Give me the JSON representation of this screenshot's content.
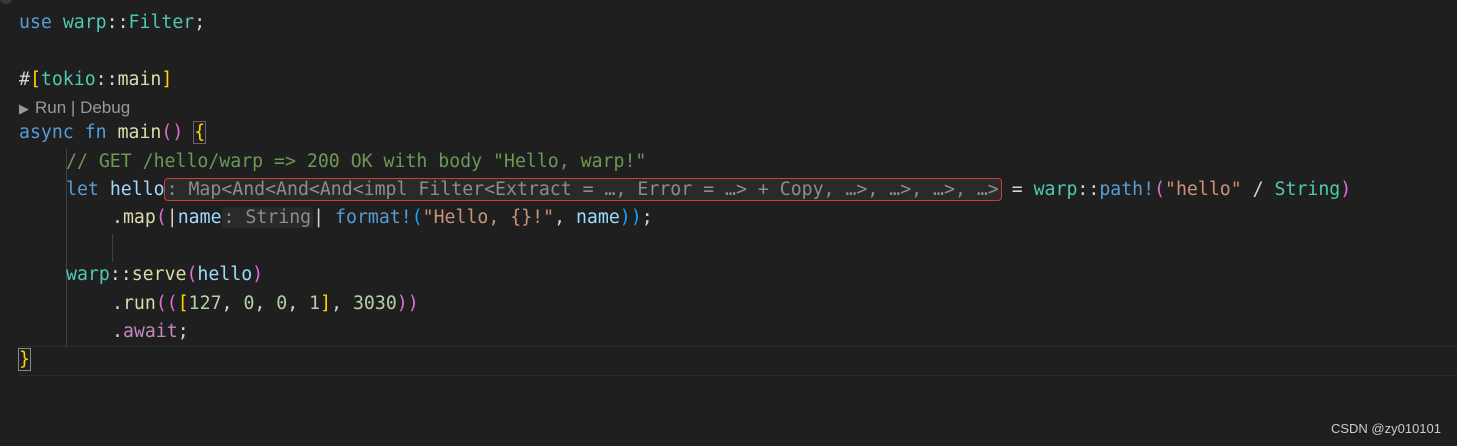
{
  "editor": {
    "line_use": {
      "kw": "use",
      "ns": "warp",
      "sep": "::",
      "type": "Filter",
      "end": ";"
    },
    "line_attr": {
      "hash": "#",
      "open": "[",
      "ns": "tokio",
      "sep": "::",
      "fn": "main",
      "close": "]"
    },
    "codelens": {
      "run": "Run",
      "separator": "|",
      "debug": "Debug"
    },
    "line_main": {
      "async": "async",
      "fn": "fn",
      "name": "main",
      "parens": "()",
      "brace": "{"
    },
    "comment": "// GET /hello/warp => 200 OK with body \"Hello, warp!\"",
    "line_let": {
      "kw": "let",
      "var": "hello",
      "type_hint": ": Map<And<And<And<impl Filter<Extract = …, Error = …> + Copy, …>, …>, …>, …>",
      "eq": "=",
      "ns": "warp",
      "sep": "::",
      "macro": "path!",
      "open": "(",
      "str": "\"hello\"",
      "slash": "/",
      "type": "String",
      "close": ")"
    },
    "line_map": {
      "dot": ".",
      "fn": "map",
      "open": "(",
      "pipe1": "|",
      "param": "name",
      "param_hint": ": String",
      "pipe2": "|",
      "macro": "format!",
      "open2": "(",
      "str": "\"Hello, {}!\"",
      "comma": ",",
      "var": "name",
      "close": "))",
      "end": ";"
    },
    "line_serve": {
      "ns": "warp",
      "sep": "::",
      "fn": "serve",
      "open": "(",
      "var": "hello",
      "close": ")"
    },
    "line_run": {
      "dot": ".",
      "fn": "run",
      "open": "((",
      "bracket_open": "[",
      "n1": "127",
      "n2": "0",
      "n3": "0",
      "n4": "1",
      "bracket_close": "]",
      "comma": ",",
      "port": "3030",
      "close": "))"
    },
    "line_await": {
      "dot": ".",
      "kw": "await",
      "end": ";"
    },
    "closing_brace": "}"
  },
  "watermark": "CSDN @zy010101",
  "colors": {
    "background": "#1f1f1f",
    "keyword": "#569cd6",
    "namespace": "#4ec9b0",
    "function": "#dcdcaa",
    "variable": "#9cdcfe",
    "string": "#ce9178",
    "number": "#b5cea8",
    "comment": "#6a9955",
    "highlight_box": "#d33b3b"
  }
}
